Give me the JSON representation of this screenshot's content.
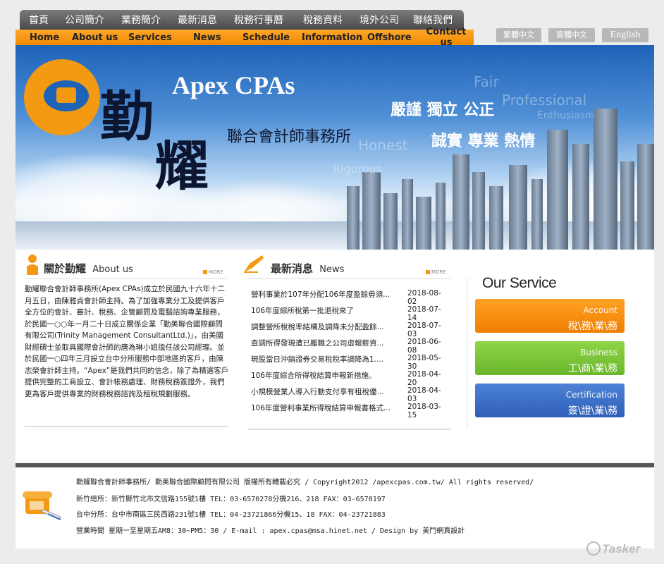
{
  "nav": {
    "zh": [
      "首頁",
      "公司簡介",
      "業務簡介",
      "最新消息",
      "稅務行事曆",
      "稅務資料",
      "境外公司",
      "聯絡我們"
    ],
    "en": [
      "Home",
      "About us",
      "Services",
      "News",
      "Schedule",
      "Information",
      "Offshore",
      "Contact us"
    ]
  },
  "lang": {
    "traditional": "繁體中文",
    "simplified": "簡體中文",
    "english": "English"
  },
  "banner": {
    "logo_char1": "勤",
    "logo_char2": "耀",
    "brand": "Apex CPAs",
    "firm": "聯合會計師事務所",
    "slogan1": "嚴謹 獨立 公正",
    "slogan2": "誠實 專業 熱情",
    "ghost_words": [
      "Fair",
      "Professional",
      "Enthusiasm",
      "Honest",
      "Rigorous"
    ]
  },
  "about": {
    "title_zh": "關於勤耀",
    "title_en": "About us",
    "more": "MORE",
    "text": "勤耀聯合會計師事務所(Apex CPAs)成立於民國九十六年十二月五日，由陳雅貞會計師主持。為了加強專業分工及提供客戶全方位的會計、審計、稅務、企管顧問及電腦諮詢專業服務，於民國一○○年一月二十日成立關係企業「勤美聯合國際顧問有限公司(Trinity Management ConsultantLtd.)」，由美國財經碩士並取具國際會計師的唐為琳小姐擔任該公司經理。並於民國一○四年三月設立台中分所服務中部地區的客戶，由陳志榮會計師主持。“Apex”是我們共同的信念，除了為精選客戶提供完整的工商設立、會計帳務處理、財務稅務簽證外，我們更為客戶提供專業的財務稅務諮詢及租稅規劃服務。"
  },
  "news": {
    "title_zh": "最新消息",
    "title_en": "News",
    "more": "MORE",
    "items": [
      {
        "title": "營利事業於107年分配106年度盈餘毋須...",
        "date": "2018-08-02"
      },
      {
        "title": "106年度綜所稅第一批退稅來了",
        "date": "2018-07-14"
      },
      {
        "title": "調整營所稅稅率結構及調降未分配盈餘...",
        "date": "2018-07-03"
      },
      {
        "title": "查調所得發現遭已離職之公司虛報薪資...",
        "date": "2018-06-08"
      },
      {
        "title": "現股當日沖銷證券交易稅稅率調降為1....",
        "date": "2018-05-30"
      },
      {
        "title": "106年度綜合所得稅結算申報新措施。",
        "date": "2018-04-20"
      },
      {
        "title": "小規模營業人導入行動支付享有租稅優...",
        "date": "2018-04-03"
      },
      {
        "title": "106年度營利事業所得稅結算申報書格式...",
        "date": "2018-03-15"
      }
    ]
  },
  "service": {
    "title": "Our Service",
    "items": [
      {
        "en": "Account",
        "zh": "稅\\務\\業\\務",
        "color": "#f5880d"
      },
      {
        "en": "Business",
        "zh": "工\\商\\業\\務",
        "color": "#7cc43a"
      },
      {
        "en": "Certification",
        "zh": "簽\\證\\業\\務",
        "color": "#3c6fc4"
      }
    ]
  },
  "footer": {
    "line1": "勤耀聯合會計師事務所/ 勤美聯合國際顧問有限公司 版權所有轉載必究 / Copyright2012 /apexcpas.com.tw/ All rights reserved/",
    "line2": "新竹總所：新竹縣竹北市文信路155號1樓 TEL：03-6570278分機216、218 FAX：03-6570197",
    "line3": "台中分所：台中市南區三民西路231號1樓 TEL：04-23721866分機15、18 FAX：04-23721883",
    "line4": "營業時間 星期一至星期五AM8：30~PM5：30 / E-mail : apex.cpas@msa.hinet.net / Design by 美鬥網頁設計"
  },
  "watermark": "Tasker"
}
